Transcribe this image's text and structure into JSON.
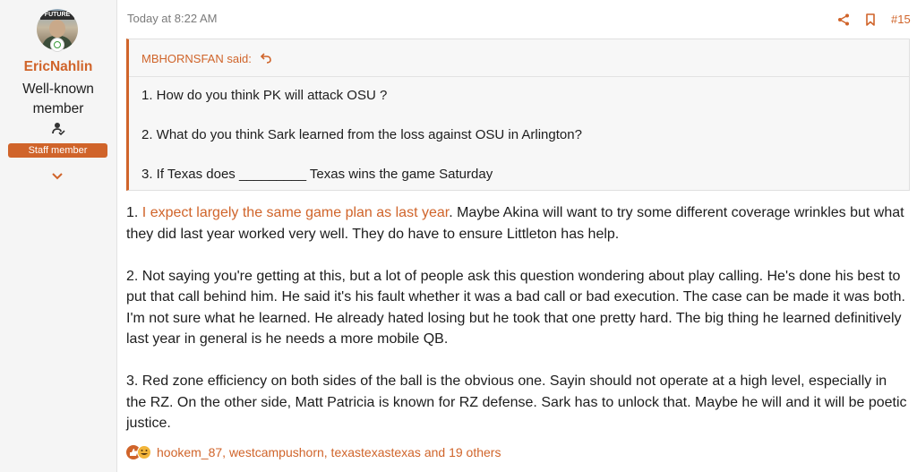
{
  "user": {
    "name": "EricNahlin",
    "title_line1": "Well-known",
    "title_line2": "member",
    "staff_badge": "Staff member",
    "avatar_text": "FUTURE"
  },
  "post": {
    "date": "Today at 8:22 AM",
    "number": "#15"
  },
  "quote": {
    "author": "MBHORNSFAN said:",
    "lines": [
      "1. How do you think PK will attack OSU ?",
      "2. What do you think Sark learned from the loss against OSU in Arlington?",
      "3. If Texas does _________ Texas wins the game Saturday"
    ]
  },
  "body": {
    "p1_prefix": "1. ",
    "p1_highlight": "I expect largely the same game plan as last year",
    "p1_rest": ". Maybe Akina will want to try some different coverage wrinkles but what they did last year worked very well. They do have to ensure Littleton has help.",
    "p2": "2. Not saying you're getting at this, but a lot of people ask this question wondering about play calling. He's done his best to put that call behind him. He said it's his fault whether it was a bad call or bad execution. The case can be made it was both. I'm not sure what he learned. He already hated losing but he took that one pretty hard. The big thing he learned definitively last year in general is he needs a more mobile QB.",
    "p3": "3. Red zone efficiency on both sides of the ball is the obvious one. Sayin should not operate at a high level, especially in the RZ. On the other side, Matt Patricia is known for RZ defense. Sark has to unlock that. Maybe he will and it will be poetic justice."
  },
  "reactions": {
    "text": "hookem_87, westcampushorn, texastexastexas and 19 others"
  },
  "colors": {
    "accent": "#d0642a",
    "sidebar_bg": "#f5f5f5",
    "quote_bg": "#f7f7f7"
  },
  "icons": {
    "share": "share-icon",
    "bookmark": "bookmark-icon",
    "quote_jump": "quote-jump-icon",
    "user_badge": "user-check-icon",
    "expand": "chevron-down-icon",
    "like": "like-reaction-icon",
    "laugh": "laugh-reaction-icon"
  }
}
